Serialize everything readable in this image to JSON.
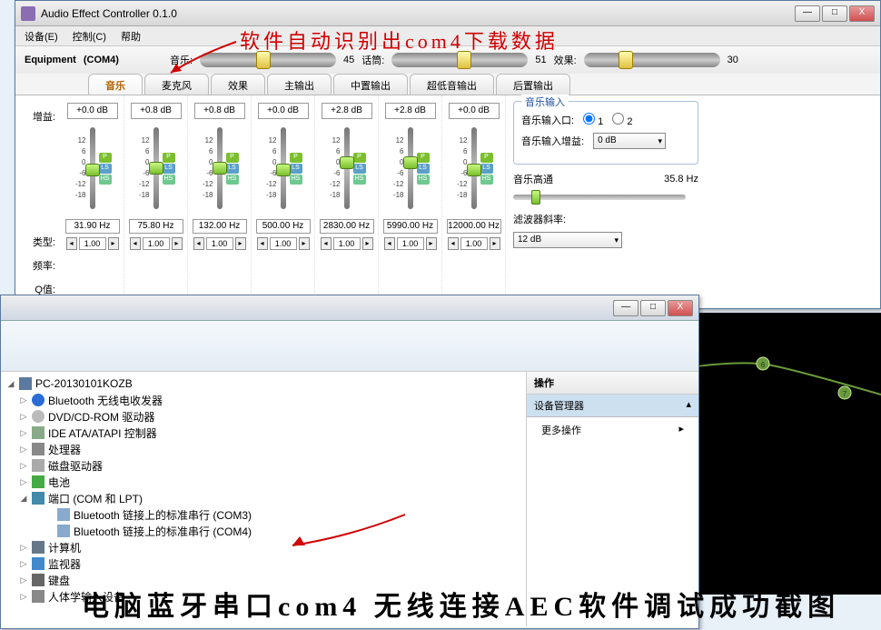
{
  "app": {
    "title": "Audio Effect Controller 0.1.0",
    "menus": [
      "设备(E)",
      "控制(C)",
      "帮助"
    ],
    "winbtns": {
      "min": "—",
      "max": "□",
      "close": "X"
    }
  },
  "eq": {
    "label_equipment": "Equipment",
    "port": "(COM4)",
    "music_lbl": "音乐:",
    "music_val": "45",
    "talk_lbl": "话筒:",
    "talk_val": "51",
    "effect_lbl": "效果:",
    "effect_val": "30"
  },
  "tabs": [
    "音乐",
    "麦克风",
    "效果",
    "主输出",
    "中置输出",
    "超低音输出",
    "后置输出"
  ],
  "rowlabels": {
    "gain": "增益:",
    "type": "类型:",
    "freq": "频率:",
    "q": "Q值:"
  },
  "ticks": [
    "12",
    "6",
    "0",
    "-6",
    "-12",
    "-18"
  ],
  "channels": [
    {
      "gain": "+0.0 dB",
      "freq": "31.90 Hz",
      "q": "1.00",
      "thumb": 40
    },
    {
      "gain": "+0.8 dB",
      "freq": "75.80 Hz",
      "q": "1.00",
      "thumb": 38
    },
    {
      "gain": "+0.8 dB",
      "freq": "132.00 Hz",
      "q": "1.00",
      "thumb": 38
    },
    {
      "gain": "+0.0 dB",
      "freq": "500.00 Hz",
      "q": "1.00",
      "thumb": 40
    },
    {
      "gain": "+2.8 dB",
      "freq": "2830.00 Hz",
      "q": "1.00",
      "thumb": 32
    },
    {
      "gain": "+2.8 dB",
      "freq": "5990.00 Hz",
      "q": "1.00",
      "thumb": 32
    },
    {
      "gain": "+0.0 dB",
      "freq": "12000.00 Hz",
      "q": "1.00",
      "thumb": 40
    }
  ],
  "right": {
    "grp_title": "音乐输入",
    "input_port_lbl": "音乐输入口:",
    "opt1": "1",
    "opt2": "2",
    "input_gain_lbl": "音乐输入增益:",
    "input_gain_val": "0 dB",
    "hp_lbl": "音乐高通",
    "hp_val": "35.8 Hz",
    "slope_lbl": "滤波器斜率:",
    "slope_val": "12 dB"
  },
  "anno": {
    "top": "软件自动识别出com4下载数据",
    "bottom": "电脑蓝牙串口com4 无线连接AEC软件调试成功截图"
  },
  "dm": {
    "winbtns": {
      "min": "—",
      "max": "□",
      "close": "X"
    },
    "root": "PC-20130101KOZB",
    "nodes": [
      {
        "ico": "ico-bt",
        "label": "Bluetooth 无线电收发器"
      },
      {
        "ico": "ico-dvd",
        "label": "DVD/CD-ROM 驱动器"
      },
      {
        "ico": "ico-ide",
        "label": "IDE ATA/ATAPI 控制器"
      },
      {
        "ico": "ico-cpu",
        "label": "处理器"
      },
      {
        "ico": "ico-disk",
        "label": "磁盘驱动器"
      },
      {
        "ico": "ico-bat",
        "label": "电池"
      }
    ],
    "ports_label": "端口 (COM 和 LPT)",
    "serial": [
      "Bluetooth 链接上的标准串行 (COM3)",
      "Bluetooth 链接上的标准串行 (COM4)"
    ],
    "tail": [
      {
        "ico": "ico-comp",
        "label": "计算机"
      },
      {
        "ico": "ico-mon",
        "label": "监视器"
      },
      {
        "ico": "ico-kb",
        "label": "键盘"
      },
      {
        "ico": "ico-hid",
        "label": "人体学输入设备"
      }
    ],
    "actions_hdr": "操作",
    "actions_sec": "设备管理器",
    "actions_more": "更多操作"
  }
}
